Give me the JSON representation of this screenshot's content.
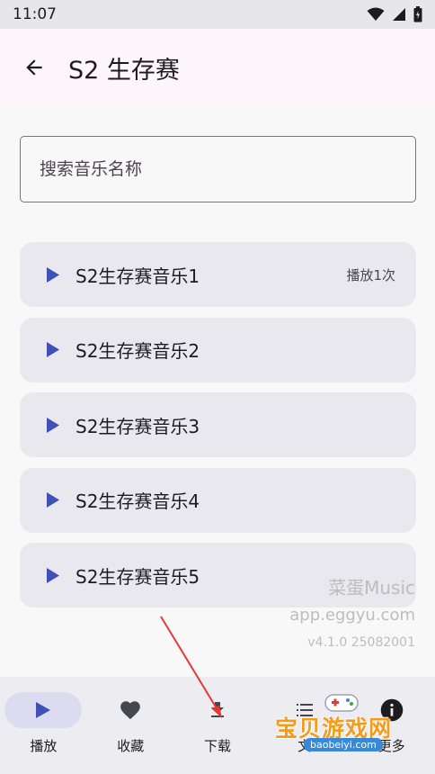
{
  "status_bar": {
    "time": "11:07"
  },
  "app_bar": {
    "title": "S2 生存赛"
  },
  "search": {
    "placeholder": "搜索音乐名称"
  },
  "tracks": [
    {
      "name": "S2生存赛音乐1",
      "play_count": "播放1次"
    },
    {
      "name": "S2生存赛音乐2",
      "play_count": ""
    },
    {
      "name": "S2生存赛音乐3",
      "play_count": ""
    },
    {
      "name": "S2生存赛音乐4",
      "play_count": ""
    },
    {
      "name": "S2生存赛音乐5",
      "play_count": ""
    }
  ],
  "watermark": {
    "name": "菜蛋Music",
    "url": "app.eggyu.com",
    "version": "v4.1.0 25082001"
  },
  "bottom_nav": [
    {
      "label": "播放",
      "icon": "play-icon",
      "active": true
    },
    {
      "label": "收藏",
      "icon": "heart-icon",
      "active": false
    },
    {
      "label": "下载",
      "icon": "download-icon",
      "active": false
    },
    {
      "label": "文",
      "icon": "list-icon",
      "active": false
    },
    {
      "label": "更多",
      "icon": "info-icon",
      "active": false
    }
  ],
  "site_badge": {
    "title": "宝贝游戏网",
    "domain": "baobeiyi.com"
  },
  "colors": {
    "accent": "#3f51b5",
    "annotation_arrow": "#e53935",
    "badge_orange": "#f29b1d"
  }
}
